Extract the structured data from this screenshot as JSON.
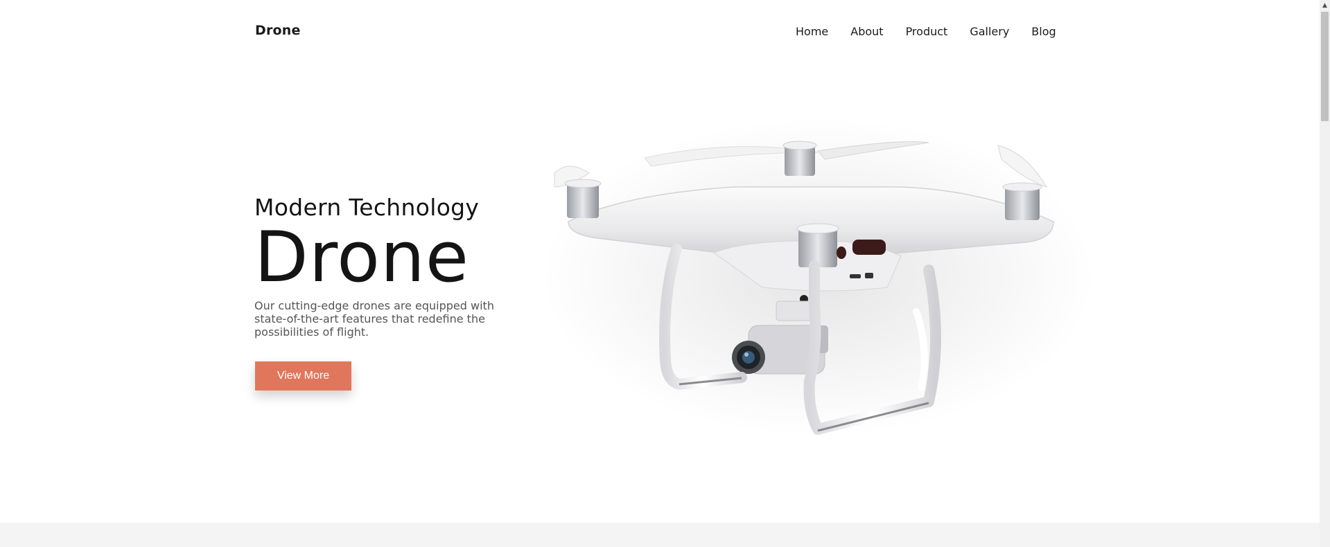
{
  "nav": {
    "brand": "Drone",
    "items": [
      {
        "label": "Home"
      },
      {
        "label": "About"
      },
      {
        "label": "Product"
      },
      {
        "label": "Gallery"
      },
      {
        "label": "Blog"
      }
    ]
  },
  "hero": {
    "subtitle": "Modern Technology",
    "headline": "Drone",
    "description": "Our cutting-edge drones are equipped with state-of-the-art features that redefine the possibilities of flight.",
    "cta_label": "View More"
  },
  "colors": {
    "accent": "#e0775d",
    "text": "#141414",
    "muted": "#555555",
    "footer_band": "#f4f4f4"
  },
  "icons": {
    "drone_image": "drone-product-image",
    "scroll_up": "scroll-up-arrow-icon"
  }
}
